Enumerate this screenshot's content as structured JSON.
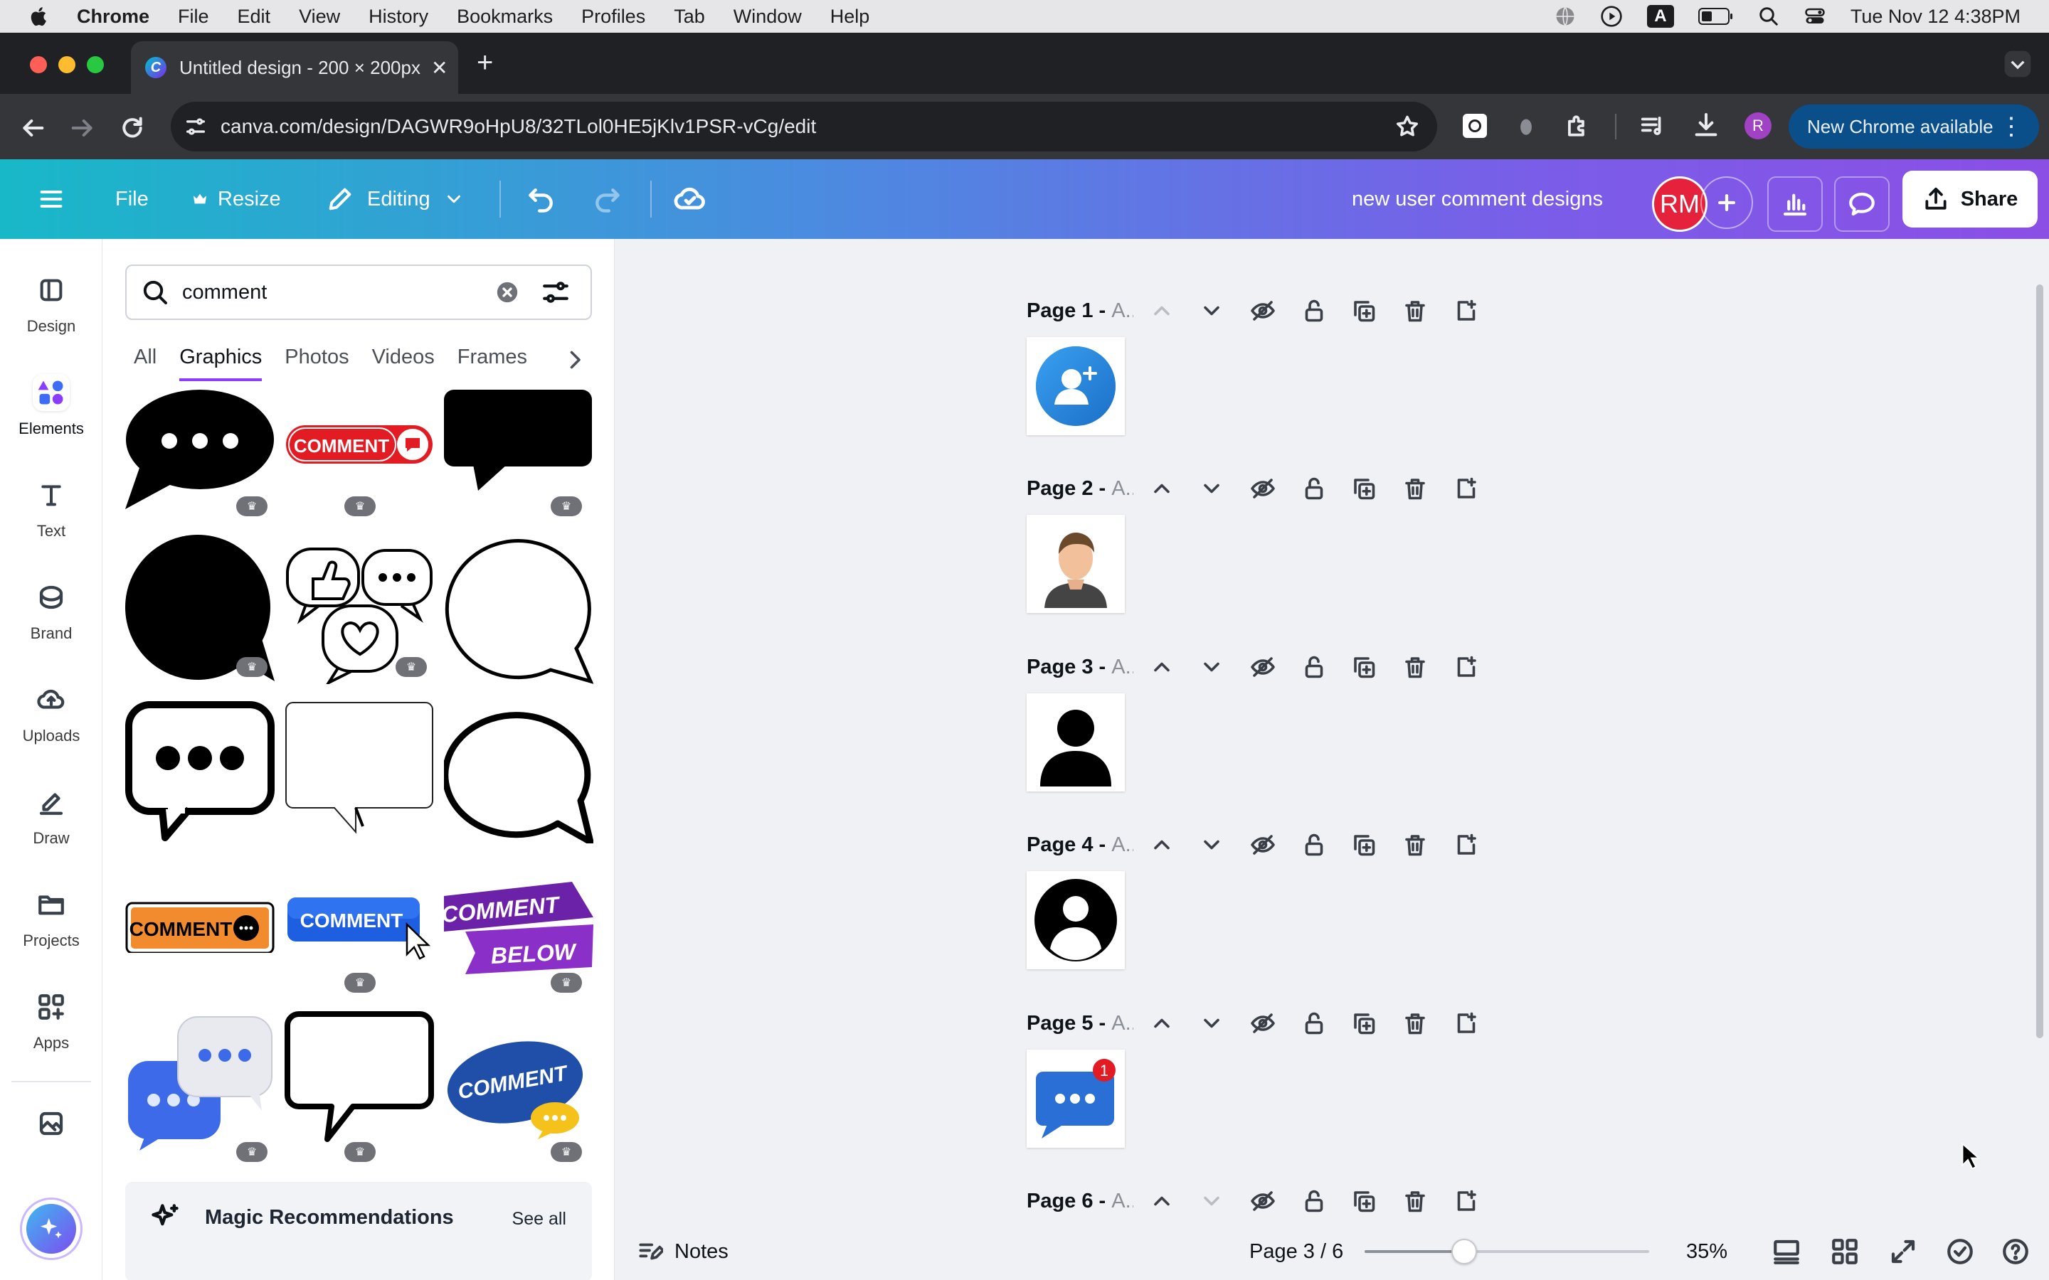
{
  "menubar": {
    "app": "Chrome",
    "items": [
      "File",
      "Edit",
      "View",
      "History",
      "Bookmarks",
      "Profiles",
      "Tab",
      "Window",
      "Help"
    ],
    "datetime": "Tue Nov 12  4:38PM"
  },
  "browser": {
    "tab_title": "Untitled design - 200 × 200px",
    "url": "canva.com/design/DAGWR9oHpU8/32TLol0HE5jKlv1PSR-vCg/edit",
    "profile_initial": "R",
    "update_label": "New Chrome available"
  },
  "header": {
    "file": "File",
    "resize": "Resize",
    "editing": "Editing",
    "design_title": "new user comment designs",
    "avatar": "RM",
    "share": "Share"
  },
  "rail": [
    {
      "label": "Design",
      "icon": "design-icon"
    },
    {
      "label": "Elements",
      "icon": "elements-icon"
    },
    {
      "label": "Text",
      "icon": "text-icon"
    },
    {
      "label": "Brand",
      "icon": "brand-icon"
    },
    {
      "label": "Uploads",
      "icon": "uploads-icon"
    },
    {
      "label": "Draw",
      "icon": "draw-icon"
    },
    {
      "label": "Projects",
      "icon": "projects-icon"
    },
    {
      "label": "Apps",
      "icon": "apps-icon"
    }
  ],
  "search": {
    "value": "comment"
  },
  "categories": [
    "All",
    "Graphics",
    "Photos",
    "Videos",
    "Frames"
  ],
  "active_category": "Graphics",
  "graphics_text": {
    "comment_red": "COMMENT",
    "comment_orange": "COMMENT",
    "comment_blue": "COMMENT",
    "comment_below_1": "COMMENT",
    "comment_below_2": "BELOW",
    "comment_oval": "COMMENT"
  },
  "magic": {
    "title": "Magic Recommendations",
    "see_all": "See all"
  },
  "pages": [
    {
      "label": "Page 1 - ",
      "suffix": "A..."
    },
    {
      "label": "Page 2 - ",
      "suffix": "A..."
    },
    {
      "label": "Page 3 - ",
      "suffix": "A..."
    },
    {
      "label": "Page 4 - ",
      "suffix": "A..."
    },
    {
      "label": "Page 5 - ",
      "suffix": "A..."
    },
    {
      "label": "Page 6 - ",
      "suffix": "A..."
    }
  ],
  "page5_badge": "1",
  "footer": {
    "notes": "Notes",
    "page_indicator": "Page 3 / 6",
    "zoom": "35%",
    "zoom_level": 0.35
  }
}
